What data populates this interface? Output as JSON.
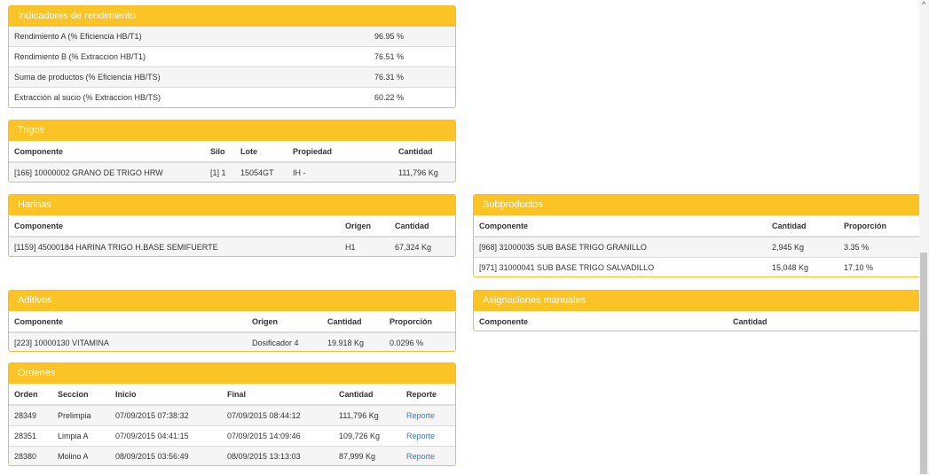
{
  "indicadores": {
    "title": "Indicadores de rendimiento",
    "rows": [
      {
        "label": "Rendimiento A (% Eficiencia HB/T1)",
        "value": "96.95 %"
      },
      {
        "label": "Rendimiento B (% Extraccion HB/T1)",
        "value": "76.51 %"
      },
      {
        "label": "Suma de productos (% Eficiencia HB/TS)",
        "value": "76.31 %"
      },
      {
        "label": "Extracción al sucio (% Extraccion HB/TS)",
        "value": "60.22 %"
      }
    ]
  },
  "trigos": {
    "title": "Trigos",
    "headers": [
      "Componente",
      "Silo",
      "Lote",
      "Propiedad",
      "Cantidad"
    ],
    "rows": [
      [
        "[166] 10000002 GRANO DE TRIGO HRW",
        "[1] 1",
        "15054GT",
        "IH -",
        "111,796 Kg"
      ]
    ]
  },
  "harinas": {
    "title": "Harinas",
    "headers": [
      "Componente",
      "Origen",
      "Cantidad"
    ],
    "rows": [
      [
        "[1159] 45000184 HARINA TRIGO H.BASE SEMIFUERTE",
        "H1",
        "67,324 Kg"
      ]
    ]
  },
  "subproductos": {
    "title": "Subproductos",
    "headers": [
      "Componente",
      "Cantidad",
      "Proporción"
    ],
    "rows": [
      [
        "[968] 31000035 SUB BASE TRIGO GRANILLO",
        "2,945 Kg",
        "3.35 %"
      ],
      [
        "[971] 31000041 SUB BASE TRIGO SALVADILLO",
        "15,048 Kg",
        "17.10 %"
      ]
    ]
  },
  "aditivos": {
    "title": "Aditivos",
    "headers": [
      "Componente",
      "Origen",
      "Cantidad",
      "Proporción"
    ],
    "rows": [
      [
        "[223] 10000130 VITAMINA",
        "Dosificador 4",
        "19.918 Kg",
        "0.0296 %"
      ]
    ]
  },
  "asignaciones": {
    "title": "Asignaciones manuales",
    "headers": [
      "Componente",
      "Cantidad"
    ]
  },
  "ordenes": {
    "title": "Ordenes",
    "headers": [
      "Orden",
      "Seccion",
      "Inicio",
      "Final",
      "Cantidad",
      "Reporte"
    ],
    "rows": [
      [
        "28349",
        "Prelimpia",
        "07/09/2015 07:38:32",
        "07/09/2015 08:44:12",
        "111,796 Kg",
        "Reporte"
      ],
      [
        "28351",
        "Limpia A",
        "07/09/2015 04:41:15",
        "07/09/2015 14:09:46",
        "109,726 Kg",
        "Reporte"
      ],
      [
        "28380",
        "Molino A",
        "08/09/2015 03:56:49",
        "08/09/2015 13:13:03",
        "87,999 Kg",
        "Reporte"
      ]
    ]
  },
  "scrollbar": {
    "up_arrow": "^"
  },
  "colors": {
    "header_bg": "#fcc326",
    "border": "#f0c030",
    "link": "#3a7dbf"
  }
}
